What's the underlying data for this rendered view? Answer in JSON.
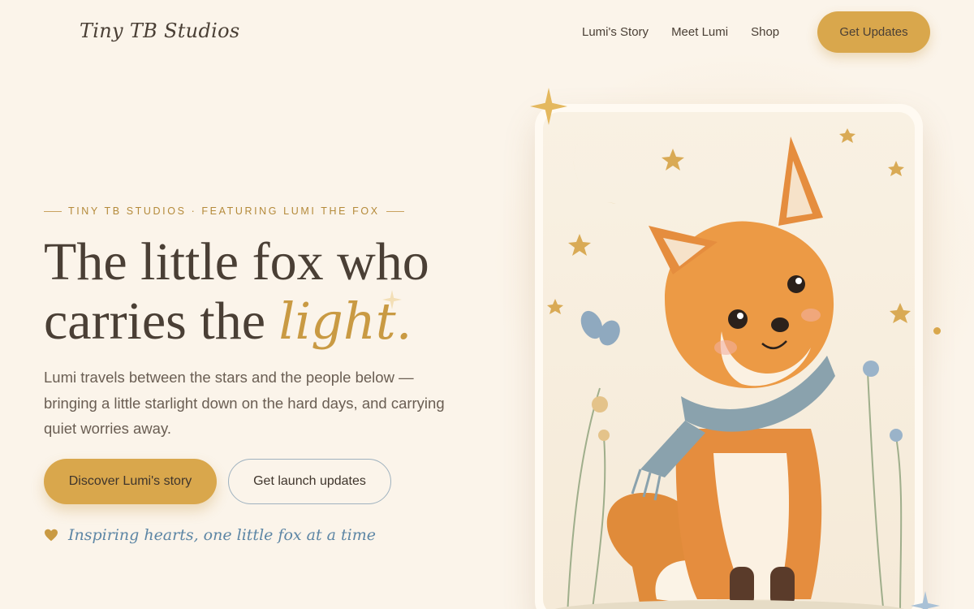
{
  "brand": {
    "name": "Tiny TB Studios",
    "icon": "moon-icon"
  },
  "nav": {
    "links": [
      "Lumi's Story",
      "Meet Lumi",
      "Shop"
    ],
    "cta_label": "Get Updates"
  },
  "hero": {
    "eyebrow": "TINY TB STUDIOS · FEATURING LUMI THE FOX",
    "headline_line1": "The little fox who",
    "headline_line2": "carries the ",
    "headline_accent": "light.",
    "lead": "Lumi travels between the stars and the people below — bringing a little starlight down on the hard days, and carrying quiet worries away.",
    "primary_button": "Discover Lumi's story",
    "secondary_button": "Get launch updates",
    "tagline": "Inspiring hearts, one little fox at a time",
    "tagline_icon": "heart-icon"
  },
  "colors": {
    "background": "#fbf4ea",
    "accent": "#d9a74c",
    "text": "#4a3f35",
    "tagline": "#5d86a5",
    "outline": "#9fb2bf"
  },
  "illustration": {
    "subject": "fox-illustration",
    "icons": [
      "crescent-moon-icon",
      "star-icon",
      "butterfly-icon",
      "sparkle-icon"
    ]
  }
}
